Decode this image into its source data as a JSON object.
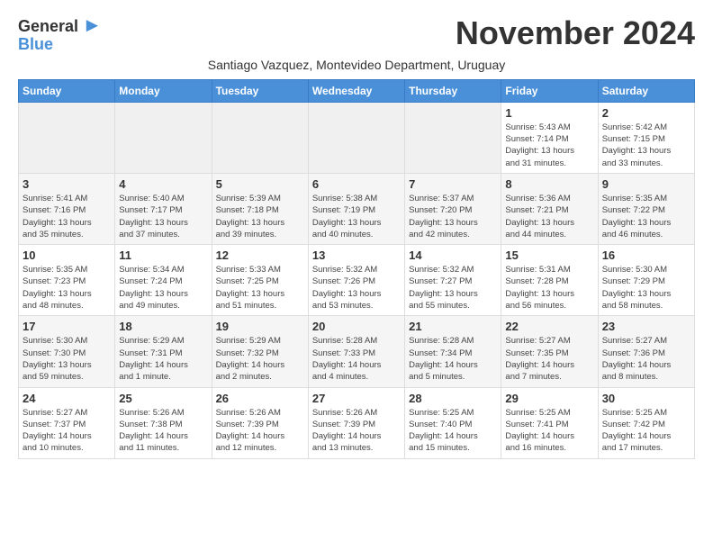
{
  "header": {
    "logo_general": "General",
    "logo_blue": "Blue",
    "month_title": "November 2024",
    "subtitle": "Santiago Vazquez, Montevideo Department, Uruguay"
  },
  "weekdays": [
    "Sunday",
    "Monday",
    "Tuesday",
    "Wednesday",
    "Thursday",
    "Friday",
    "Saturday"
  ],
  "weeks": [
    [
      {
        "day": "",
        "info": ""
      },
      {
        "day": "",
        "info": ""
      },
      {
        "day": "",
        "info": ""
      },
      {
        "day": "",
        "info": ""
      },
      {
        "day": "",
        "info": ""
      },
      {
        "day": "1",
        "info": "Sunrise: 5:43 AM\nSunset: 7:14 PM\nDaylight: 13 hours\nand 31 minutes."
      },
      {
        "day": "2",
        "info": "Sunrise: 5:42 AM\nSunset: 7:15 PM\nDaylight: 13 hours\nand 33 minutes."
      }
    ],
    [
      {
        "day": "3",
        "info": "Sunrise: 5:41 AM\nSunset: 7:16 PM\nDaylight: 13 hours\nand 35 minutes."
      },
      {
        "day": "4",
        "info": "Sunrise: 5:40 AM\nSunset: 7:17 PM\nDaylight: 13 hours\nand 37 minutes."
      },
      {
        "day": "5",
        "info": "Sunrise: 5:39 AM\nSunset: 7:18 PM\nDaylight: 13 hours\nand 39 minutes."
      },
      {
        "day": "6",
        "info": "Sunrise: 5:38 AM\nSunset: 7:19 PM\nDaylight: 13 hours\nand 40 minutes."
      },
      {
        "day": "7",
        "info": "Sunrise: 5:37 AM\nSunset: 7:20 PM\nDaylight: 13 hours\nand 42 minutes."
      },
      {
        "day": "8",
        "info": "Sunrise: 5:36 AM\nSunset: 7:21 PM\nDaylight: 13 hours\nand 44 minutes."
      },
      {
        "day": "9",
        "info": "Sunrise: 5:35 AM\nSunset: 7:22 PM\nDaylight: 13 hours\nand 46 minutes."
      }
    ],
    [
      {
        "day": "10",
        "info": "Sunrise: 5:35 AM\nSunset: 7:23 PM\nDaylight: 13 hours\nand 48 minutes."
      },
      {
        "day": "11",
        "info": "Sunrise: 5:34 AM\nSunset: 7:24 PM\nDaylight: 13 hours\nand 49 minutes."
      },
      {
        "day": "12",
        "info": "Sunrise: 5:33 AM\nSunset: 7:25 PM\nDaylight: 13 hours\nand 51 minutes."
      },
      {
        "day": "13",
        "info": "Sunrise: 5:32 AM\nSunset: 7:26 PM\nDaylight: 13 hours\nand 53 minutes."
      },
      {
        "day": "14",
        "info": "Sunrise: 5:32 AM\nSunset: 7:27 PM\nDaylight: 13 hours\nand 55 minutes."
      },
      {
        "day": "15",
        "info": "Sunrise: 5:31 AM\nSunset: 7:28 PM\nDaylight: 13 hours\nand 56 minutes."
      },
      {
        "day": "16",
        "info": "Sunrise: 5:30 AM\nSunset: 7:29 PM\nDaylight: 13 hours\nand 58 minutes."
      }
    ],
    [
      {
        "day": "17",
        "info": "Sunrise: 5:30 AM\nSunset: 7:30 PM\nDaylight: 13 hours\nand 59 minutes."
      },
      {
        "day": "18",
        "info": "Sunrise: 5:29 AM\nSunset: 7:31 PM\nDaylight: 14 hours\nand 1 minute."
      },
      {
        "day": "19",
        "info": "Sunrise: 5:29 AM\nSunset: 7:32 PM\nDaylight: 14 hours\nand 2 minutes."
      },
      {
        "day": "20",
        "info": "Sunrise: 5:28 AM\nSunset: 7:33 PM\nDaylight: 14 hours\nand 4 minutes."
      },
      {
        "day": "21",
        "info": "Sunrise: 5:28 AM\nSunset: 7:34 PM\nDaylight: 14 hours\nand 5 minutes."
      },
      {
        "day": "22",
        "info": "Sunrise: 5:27 AM\nSunset: 7:35 PM\nDaylight: 14 hours\nand 7 minutes."
      },
      {
        "day": "23",
        "info": "Sunrise: 5:27 AM\nSunset: 7:36 PM\nDaylight: 14 hours\nand 8 minutes."
      }
    ],
    [
      {
        "day": "24",
        "info": "Sunrise: 5:27 AM\nSunset: 7:37 PM\nDaylight: 14 hours\nand 10 minutes."
      },
      {
        "day": "25",
        "info": "Sunrise: 5:26 AM\nSunset: 7:38 PM\nDaylight: 14 hours\nand 11 minutes."
      },
      {
        "day": "26",
        "info": "Sunrise: 5:26 AM\nSunset: 7:39 PM\nDaylight: 14 hours\nand 12 minutes."
      },
      {
        "day": "27",
        "info": "Sunrise: 5:26 AM\nSunset: 7:39 PM\nDaylight: 14 hours\nand 13 minutes."
      },
      {
        "day": "28",
        "info": "Sunrise: 5:25 AM\nSunset: 7:40 PM\nDaylight: 14 hours\nand 15 minutes."
      },
      {
        "day": "29",
        "info": "Sunrise: 5:25 AM\nSunset: 7:41 PM\nDaylight: 14 hours\nand 16 minutes."
      },
      {
        "day": "30",
        "info": "Sunrise: 5:25 AM\nSunset: 7:42 PM\nDaylight: 14 hours\nand 17 minutes."
      }
    ]
  ]
}
